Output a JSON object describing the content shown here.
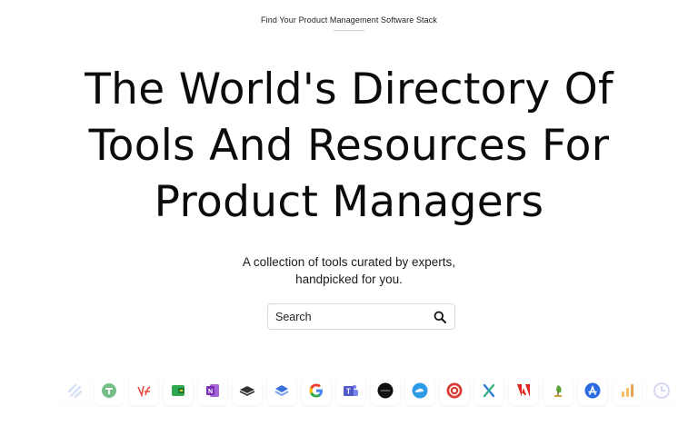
{
  "header": {
    "eyebrow": "Find Your Product Management Software Stack"
  },
  "hero": {
    "title_lines": [
      "The World's Directory Of",
      "Tools And Resources For",
      "Product Managers"
    ],
    "subtitle_lines": [
      "A collection of tools curated by experts,",
      "handpicked for you."
    ]
  },
  "search": {
    "placeholder": "Search",
    "icon": "magnifier-icon"
  },
  "logos": [
    {
      "name": "stripes-logo-icon",
      "color": "#7fa6e0"
    },
    {
      "name": "green-circle-logo-icon",
      "color": "#3aa556"
    },
    {
      "name": "red-script-logo-icon",
      "color": "#e0453b"
    },
    {
      "name": "green-folder-logo-icon",
      "color": "#2fa84f"
    },
    {
      "name": "onenote-logo-icon",
      "color": "#7b2fb5"
    },
    {
      "name": "stack-book-logo-icon",
      "color": "#333333"
    },
    {
      "name": "layers-logo-icon",
      "color": "#3a6fe0"
    },
    {
      "name": "google-logo-icon",
      "color": "#4285f4"
    },
    {
      "name": "teams-logo-icon",
      "color": "#5059c9"
    },
    {
      "name": "black-circle-logo-icon",
      "color": "#111111"
    },
    {
      "name": "cloud-logo-icon",
      "color": "#2d9be6"
    },
    {
      "name": "red-target-logo-icon",
      "color": "#d93b35"
    },
    {
      "name": "x-logo-icon",
      "color": "#2f7be0"
    },
    {
      "name": "adobe-logo-icon",
      "color": "#e0261f"
    },
    {
      "name": "leaf-logo-icon",
      "color": "#5aa33a"
    },
    {
      "name": "appstore-logo-icon",
      "color": "#2b6be0"
    },
    {
      "name": "bars-logo-icon",
      "color": "#f2a31b"
    },
    {
      "name": "clock-logo-icon",
      "color": "#8a8de0"
    }
  ]
}
